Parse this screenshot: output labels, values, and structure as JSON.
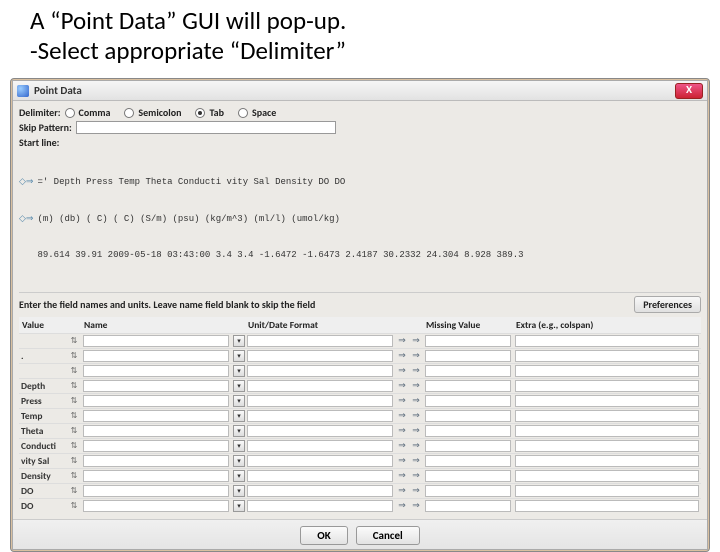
{
  "slide": {
    "line1": "A “Point Data” GUI will pop-up.",
    "line2": "-Select appropriate “Delimiter”"
  },
  "window": {
    "title": "Point Data",
    "close": "X",
    "delimiter_label": "Delimiter:",
    "delimiters": {
      "comma": "Comma",
      "semicolon": "Semicolon",
      "tab": "Tab",
      "space": "Space",
      "selected": "tab"
    },
    "skip_label": "Skip Pattern:",
    "skip_value": "",
    "startline_label": "Start line:",
    "preview_header": "=' Depth Press Temp Theta Conducti vity Sal Density DO DO",
    "preview_units": "(m) (db) ( C) ( C) (S/m) (psu) (kg/m^3) (ml/l) (umol/kg)",
    "preview_data": "89.614 39.91 2009-05-18 03:43:00 3.4 3.4 -1.6472 -1.6473 2.4187 30.2332 24.304 8.928 389.3",
    "fields_instr": "Enter the field names and units. Leave name field blank to skip the field",
    "preferences": "Preferences",
    "columns": {
      "value": "Value",
      "name": "Name",
      "unit": "Unit/Date Format",
      "missing": "Missing Value",
      "extra": "Extra (e.g., colspan)"
    },
    "rows": [
      {
        "value": ""
      },
      {
        "value": "."
      },
      {
        "value": ""
      },
      {
        "value": "Depth"
      },
      {
        "value": "Press"
      },
      {
        "value": "Temp"
      },
      {
        "value": "Theta"
      },
      {
        "value": "Conducti"
      },
      {
        "value": "vity Sal"
      },
      {
        "value": "Density"
      },
      {
        "value": "DO"
      },
      {
        "value": "DO"
      }
    ],
    "ok": "OK",
    "cancel": "Cancel"
  }
}
